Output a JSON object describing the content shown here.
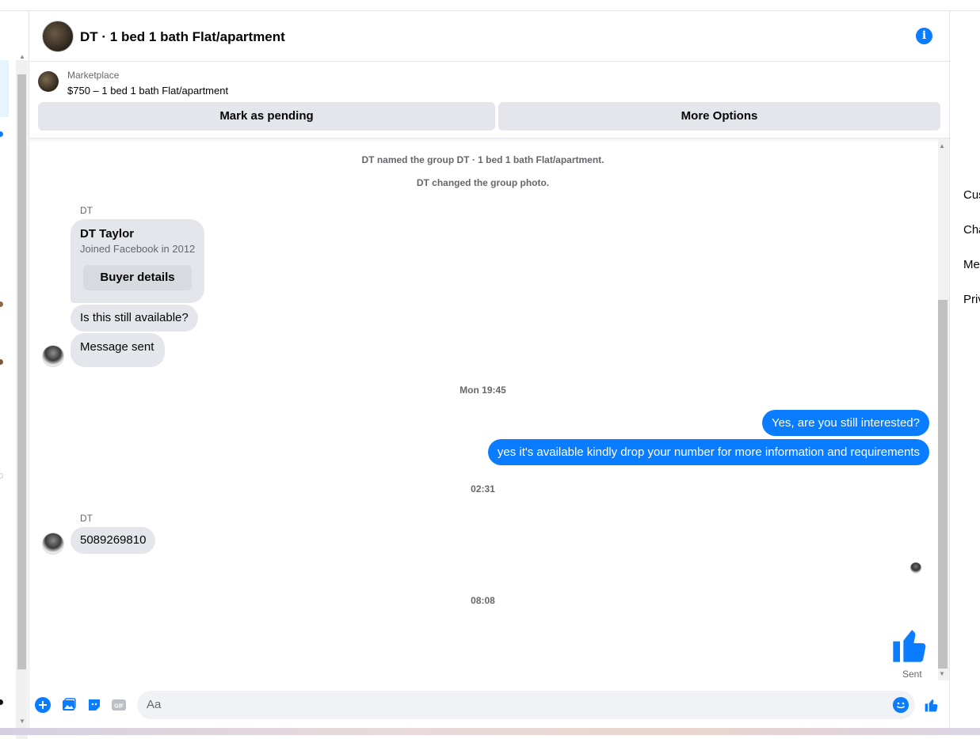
{
  "header": {
    "title": "DT · 1 bed 1 bath Flat/apartment"
  },
  "marketplace": {
    "label": "Marketplace",
    "listing": "$750 – 1 bed 1 bath Flat/apartment",
    "pending_button": "Mark as pending",
    "more_button": "More Options"
  },
  "chat": {
    "system_1": "DT named the group DT · 1 bed 1 bath Flat/apartment.",
    "system_2": "DT changed the group photo.",
    "sender_1": "DT",
    "profile_name": "DT Taylor",
    "profile_joined": "Joined Facebook in 2012",
    "buyer_details_button": "Buyer details",
    "msg_available": "Is this still available?",
    "msg_sent_notice": "Message sent",
    "time_1": "Mon 19:45",
    "out_1": "Yes, are you still interested?",
    "out_2": "yes it's available kindly drop your number for more information and requirements",
    "time_2": "02:31",
    "sender_2": "DT",
    "msg_number": "5089269810",
    "time_3": "08:08",
    "sent_status": "Sent"
  },
  "composer": {
    "placeholder": "Aa",
    "icons": [
      "plus-icon",
      "photo-icon",
      "sticker-icon",
      "gif-icon",
      "emoji-icon",
      "like-icon"
    ]
  },
  "right_panel": {
    "items": [
      "Cus",
      "Cha",
      "Me",
      "Priv"
    ]
  },
  "colors": {
    "accent": "#0a7cff",
    "bubble_in": "#e4e6eb",
    "secondary_text": "#65676b"
  }
}
